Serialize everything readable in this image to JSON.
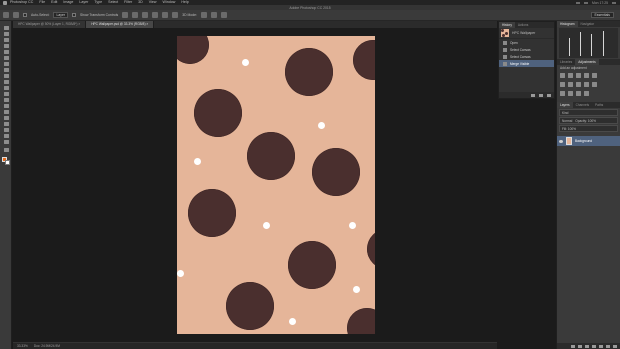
{
  "menubar": {
    "items": [
      "Photoshop CC",
      "File",
      "Edit",
      "Image",
      "Layer",
      "Type",
      "Select",
      "Filter",
      "3D",
      "View",
      "Window",
      "Help"
    ],
    "clock": "Mon 17:25"
  },
  "window": {
    "title": "Adobe Photoshop CC 2015"
  },
  "options": {
    "auto_select_label": "Auto-Select:",
    "auto_select_value": "Layer",
    "transform_label": "Show Transform Controls",
    "mode_3d_label": "3D Mode:",
    "workspace": "Essentials"
  },
  "doc_tabs": [
    {
      "label": "HPC Wallpaper @ 50% (Layer 1, RGB/8*) ×",
      "active": false
    },
    {
      "label": "HPC Wallpaper.psd @ 33.3% (RGB/8) ×",
      "active": true
    }
  ],
  "status": {
    "zoom": "33.33%",
    "doc_size": "Doc: 24.9M/24.9M"
  },
  "history": {
    "tabs": [
      "History",
      "Actions"
    ],
    "snapshot": "HPC Wallpaper",
    "rows": [
      {
        "label": "Open",
        "active": false
      },
      {
        "label": "Select Canvas",
        "active": false
      },
      {
        "label": "Select Canvas",
        "active": false
      },
      {
        "label": "Merge Visible",
        "active": true
      }
    ]
  },
  "histogram": {
    "tabs": [
      "Histogram",
      "Navigator"
    ]
  },
  "adjustments": {
    "tabs": [
      "Libraries",
      "Adjustments"
    ],
    "subtitle": "Add an adjustment"
  },
  "layers": {
    "tabs": [
      "Layers",
      "Channels",
      "Paths"
    ],
    "filter": "Kind",
    "blend_mode": "Normal",
    "opacity": "Opacity: 100%",
    "fill": "Fill: 100%",
    "layer_name": "Background"
  },
  "colors": {
    "canvas": "#e5b599",
    "dot": "#4a2f2e",
    "accent": "#4f627e"
  }
}
